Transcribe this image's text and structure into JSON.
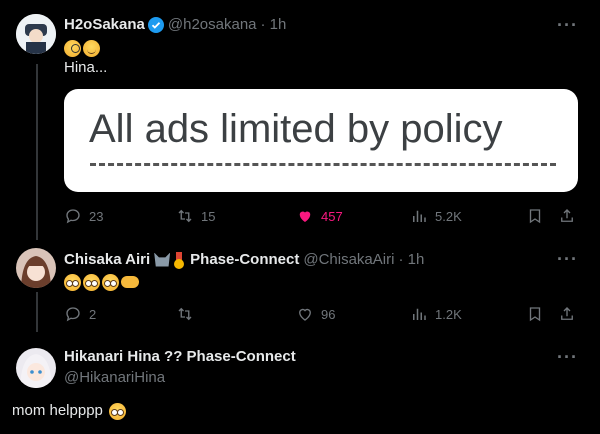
{
  "tweets": [
    {
      "name": "H2oSakana",
      "handle": "@h2osakana",
      "time": "· 1h",
      "verified": true,
      "text": "Hina...",
      "media_text": "All ads limited by policy",
      "actions": {
        "replies": "23",
        "retweets": "15",
        "likes": "457",
        "views": "5.2K"
      }
    },
    {
      "name": "Chisaka Airi",
      "name_suffix": "Phase-Connect",
      "handle": "@ChisakaAiri",
      "time": "· 1h",
      "actions": {
        "replies": "2",
        "retweets": "",
        "likes": "96",
        "views": "1.2K"
      }
    },
    {
      "name": "Hikanari Hina ?? Phase-Connect",
      "handle": "@HikanariHina",
      "text": "mom helpppp"
    }
  ],
  "icons": {
    "reply": "reply-icon",
    "retweet": "retweet-icon",
    "like": "heart-icon",
    "views": "views-icon",
    "bookmark": "bookmark-icon",
    "share": "share-icon",
    "more": "more-icon",
    "verified": "verified-badge-icon"
  },
  "colors": {
    "background": "#000000",
    "like_active": "#f91880",
    "muted": "#71767b",
    "verified": "#1d9bf0"
  }
}
